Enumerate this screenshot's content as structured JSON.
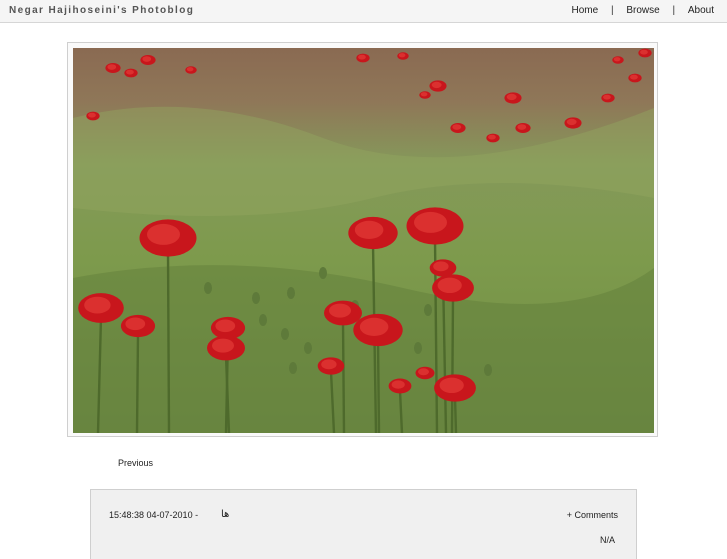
{
  "header": {
    "site_title": "Negar Hajihoseini's Photoblog",
    "nav": {
      "home": "Home",
      "browse": "Browse",
      "about": "About",
      "separator": "|"
    }
  },
  "photo": {
    "subject": "red-poppies-in-field"
  },
  "navigation": {
    "previous": "Previous"
  },
  "info": {
    "timestamp": "15:48:38 04-07-2010 -",
    "title": "ها",
    "comments": "+ Comments",
    "exif": "N/A"
  },
  "colors": {
    "topbar_bg": "#f5f5f5",
    "info_bg": "#f0f0f0",
    "poppy_red": "#c8161c",
    "grass_green": "#7f9a4a"
  }
}
